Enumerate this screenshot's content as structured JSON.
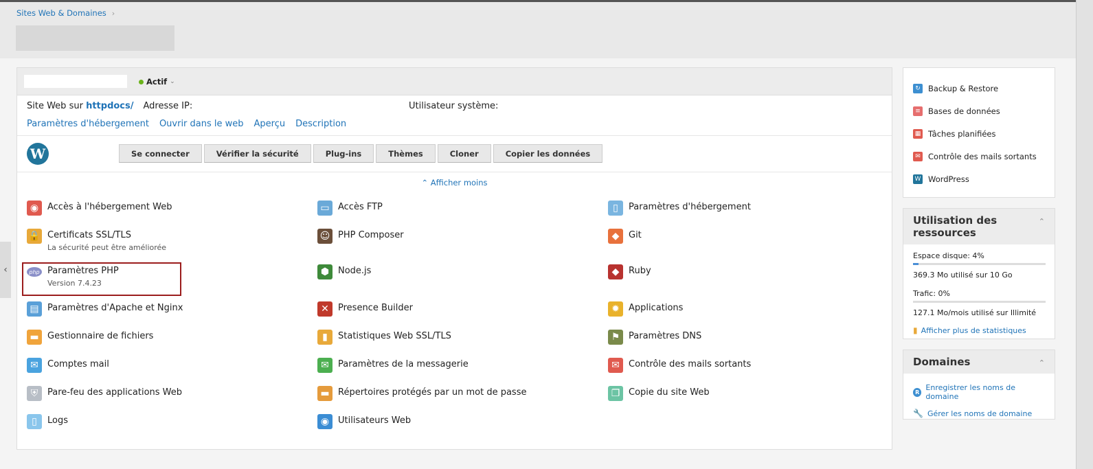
{
  "breadcrumb": {
    "item": "Sites Web & Domaines",
    "separator": "›"
  },
  "subscription": {
    "status": "Actif",
    "status_caret": "⌄",
    "site_label": "Site Web sur",
    "site_path": "httpdocs/",
    "ip_label": "Adresse IP:",
    "sys_user_label": "Utilisateur système:",
    "links": [
      "Paramètres d'hébergement",
      "Ouvrir dans le web",
      "Aperçu",
      "Description"
    ]
  },
  "wordpress": {
    "logo": "W",
    "buttons": [
      "Se connecter",
      "Vérifier la sécurité",
      "Plug-ins",
      "Thèmes",
      "Cloner",
      "Copier les données"
    ]
  },
  "show_less": "⌃ Afficher moins",
  "tools": {
    "c1": [
      {
        "label": "Accès à l'hébergement Web",
        "icon": "globe-icon",
        "color": "#e05a4f",
        "glyph": "◉"
      },
      {
        "label": "Certificats SSL/TLS",
        "sub": "La sécurité peut être améliorée",
        "icon": "lock-icon",
        "color": "#e8a93a",
        "glyph": "🔒"
      },
      {
        "label": "Paramètres PHP",
        "sub": "Version 7.4.23",
        "icon": "php-icon",
        "color": "#8a8fc8",
        "glyph": "php"
      },
      {
        "label": "Paramètres d'Apache et Nginx",
        "icon": "server-icon",
        "color": "#5aa0d8",
        "glyph": "▤"
      },
      {
        "label": "Gestionnaire de fichiers",
        "icon": "folder-icon",
        "color": "#f0a43c",
        "glyph": "▬"
      },
      {
        "label": "Comptes mail",
        "icon": "mail-icon",
        "color": "#4aa3df",
        "glyph": "✉"
      },
      {
        "label": "Pare-feu des applications Web",
        "icon": "shield-icon",
        "color": "#b8bec6",
        "glyph": "⛨"
      },
      {
        "label": "Logs",
        "icon": "log-icon",
        "color": "#8ac6ec",
        "glyph": "▯"
      }
    ],
    "c2": [
      {
        "label": "Accès FTP",
        "icon": "ftp-icon",
        "color": "#6aa9d8",
        "glyph": "▭"
      },
      {
        "label": "PHP Composer",
        "icon": "composer-icon",
        "color": "#6b4f3a",
        "glyph": "☺"
      },
      {
        "label": "Node.js",
        "icon": "nodejs-icon",
        "color": "#3e8a3a",
        "glyph": "⬢"
      },
      {
        "label": "Presence Builder",
        "icon": "tools-icon",
        "color": "#c0392b",
        "glyph": "✕"
      },
      {
        "label": "Statistiques Web SSL/TLS",
        "icon": "stats-icon",
        "color": "#e8a93a",
        "glyph": "▮"
      },
      {
        "label": "Paramètres de la messagerie",
        "icon": "mail-settings-icon",
        "color": "#4caf50",
        "glyph": "✉"
      },
      {
        "label": "Répertoires protégés par un mot de passe",
        "icon": "protected-folder-icon",
        "color": "#e59b3c",
        "glyph": "▬"
      },
      {
        "label": "Utilisateurs Web",
        "icon": "web-users-icon",
        "color": "#3b8dd4",
        "glyph": "◉"
      }
    ],
    "c3": [
      {
        "label": "Paramètres d'hébergement",
        "icon": "hosting-settings-icon",
        "color": "#7ab5e0",
        "glyph": "▯"
      },
      {
        "label": "Git",
        "icon": "git-icon",
        "color": "#e8713c",
        "glyph": "◆"
      },
      {
        "label": "Ruby",
        "icon": "ruby-icon",
        "color": "#b8322f",
        "glyph": "◆"
      },
      {
        "label": "Applications",
        "icon": "gear-icon",
        "color": "#e9b22b",
        "glyph": "✹"
      },
      {
        "label": "Paramètres DNS",
        "icon": "dns-icon",
        "color": "#7a8a4a",
        "glyph": "⚑"
      },
      {
        "label": "Contrôle des mails sortants",
        "icon": "outgoing-mail-icon",
        "color": "#e05a4f",
        "glyph": "✉"
      },
      {
        "label": "Copie du site Web",
        "icon": "copy-icon",
        "color": "#6cc4a4",
        "glyph": "❐"
      }
    ]
  },
  "side": {
    "items": [
      {
        "label": "Backup & Restore",
        "icon": "backup-icon",
        "color": "#3d8fd1",
        "glyph": "↻"
      },
      {
        "label": "Bases de données",
        "icon": "database-icon",
        "color": "#e66e6e",
        "glyph": "≡"
      },
      {
        "label": "Tâches planifiées",
        "icon": "calendar-icon",
        "color": "#e05a4f",
        "glyph": "▦"
      },
      {
        "label": "Contrôle des mails sortants",
        "icon": "outgoing-mail-icon",
        "color": "#e05a4f",
        "glyph": "✉"
      },
      {
        "label": "WordPress",
        "icon": "wordpress-icon",
        "color": "#21759b",
        "glyph": "W"
      }
    ],
    "resources": {
      "title": "Utilisation des ressources",
      "chevron": "⌃",
      "disk_label": "Espace disque: 4%",
      "disk_percent": 4,
      "disk_detail": "369.3 Mo utilisé sur 10 Go",
      "traffic_label": "Trafic: 0%",
      "traffic_percent": 0,
      "traffic_detail": "127.1 Mo/mois utilisé sur Illimité",
      "more_stats": "Afficher plus de statistiques"
    },
    "domains": {
      "title": "Domaines",
      "chevron": "⌃",
      "register": "Enregistrer les noms de domaine",
      "manage": "Gérer les noms de domaine"
    }
  },
  "left_tab_glyph": "‹"
}
